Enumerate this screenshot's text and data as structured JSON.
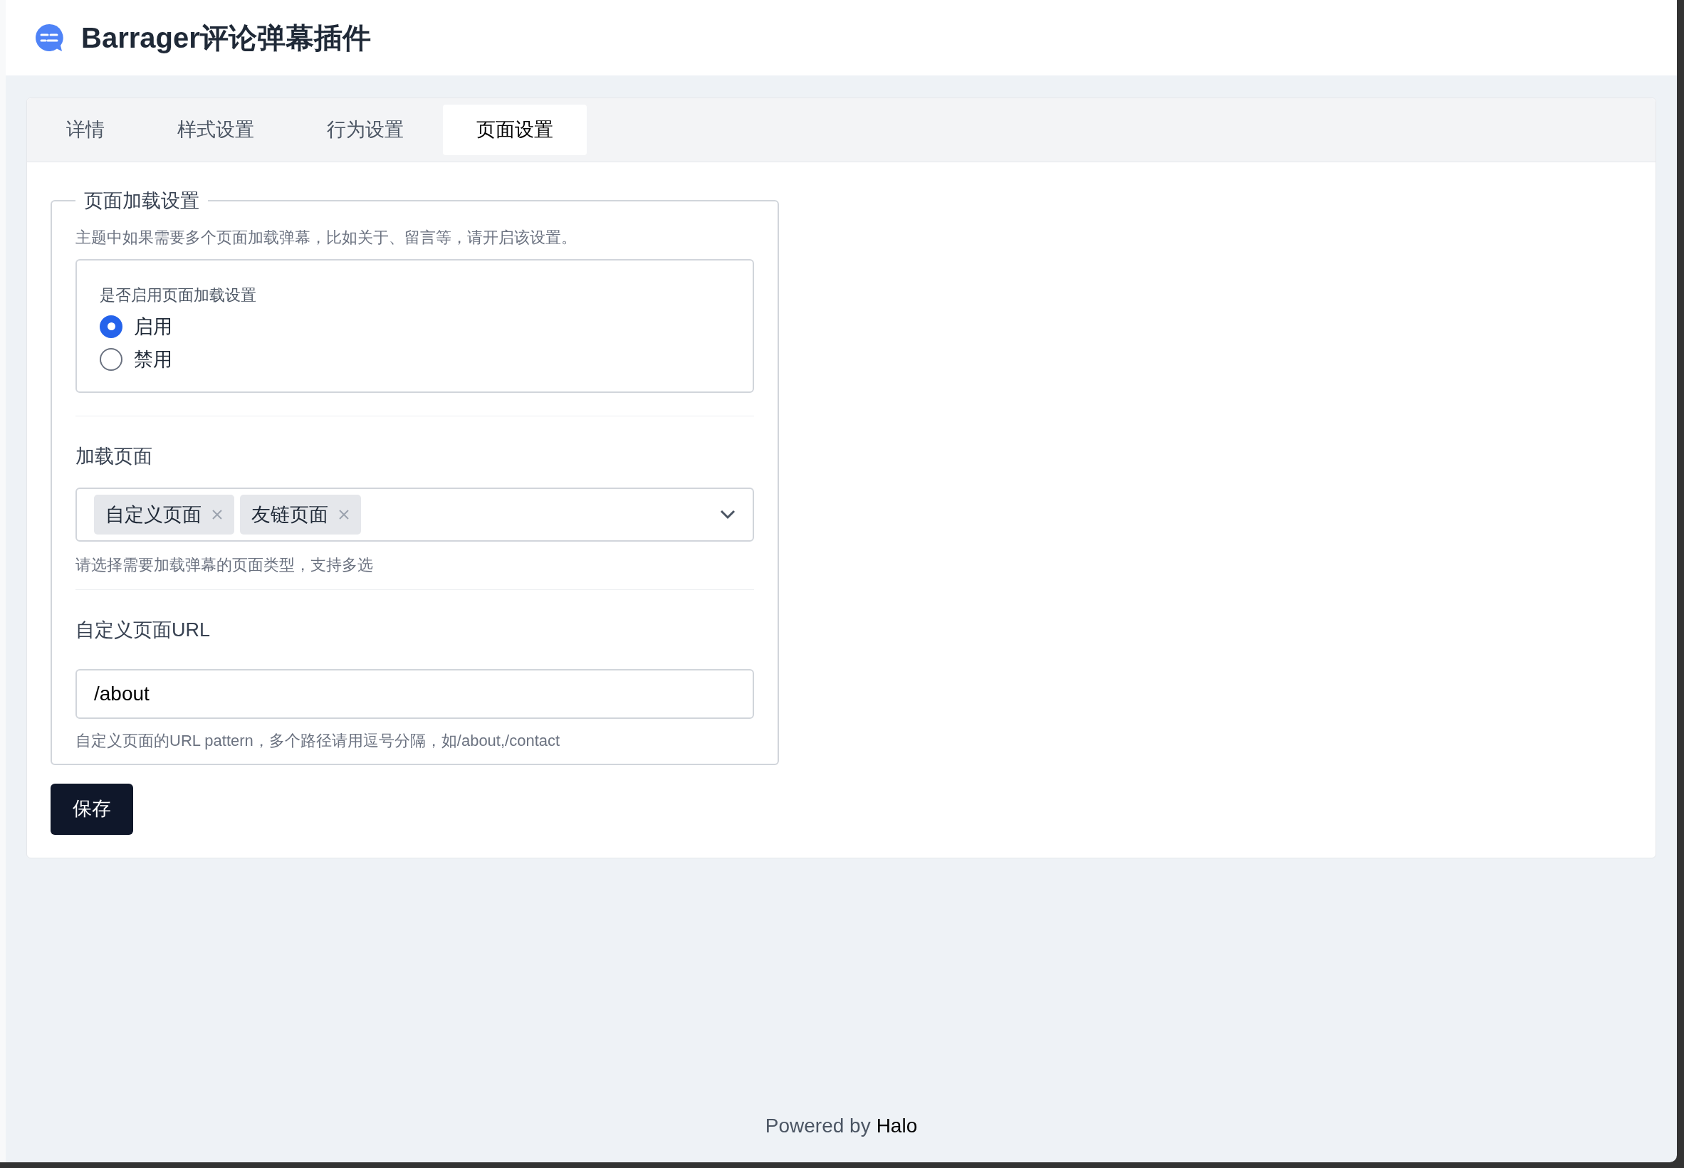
{
  "header": {
    "title": "Barrager评论弹幕插件"
  },
  "tabs": [
    {
      "label": "详情",
      "selected": false
    },
    {
      "label": "样式设置",
      "selected": false
    },
    {
      "label": "行为设置",
      "selected": false
    },
    {
      "label": "页面设置",
      "selected": true
    }
  ],
  "fieldset": {
    "legend": "页面加载设置",
    "description": "主题中如果需要多个页面加载弹幕，比如关于、留言等，请开启该设置。",
    "radio_group": {
      "label": "是否启用页面加载设置",
      "options": [
        {
          "label": "启用",
          "selected": true
        },
        {
          "label": "禁用",
          "selected": false
        }
      ]
    },
    "multi_select": {
      "label": "加载页面",
      "tags": [
        "自定义页面",
        "友链页面"
      ],
      "help": "请选择需要加载弹幕的页面类型，支持多选"
    },
    "url_field": {
      "label": "自定义页面URL",
      "value": "/about",
      "help": "自定义页面的URL pattern，多个路径请用逗号分隔，如/about,/contact"
    }
  },
  "save_button": "保存",
  "footer": {
    "text": "Powered by",
    "link": "Halo"
  }
}
